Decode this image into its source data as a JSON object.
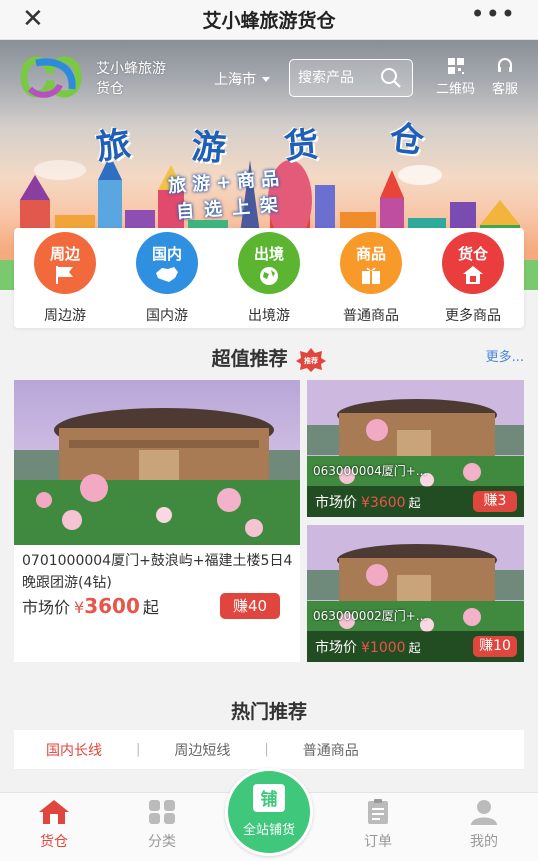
{
  "titlebar": {
    "title": "艾小蜂旅游货仓",
    "close_icon": "close-icon",
    "more_icon": "more-dots-icon"
  },
  "header": {
    "brand_line1": "艾小蜂旅游",
    "brand_line2": "货仓",
    "city": "上海市",
    "search_placeholder": "搜索产品",
    "qr_label": "二维码",
    "service_label": "客服"
  },
  "banner": {
    "headline": [
      "旅",
      "游",
      "货",
      "仓"
    ],
    "subline1": "旅游+商品",
    "subline2": "自选上架"
  },
  "categories": [
    {
      "icon_text": "周边",
      "label": "周边游",
      "color": "#f26a3b",
      "icon": "flag-icon"
    },
    {
      "icon_text": "国内",
      "label": "国内游",
      "color": "#2f8fe0",
      "icon": "china-map-icon"
    },
    {
      "icon_text": "出境",
      "label": "出境游",
      "color": "#5cb531",
      "icon": "globe-icon"
    },
    {
      "icon_text": "商品",
      "label": "普通商品",
      "color": "#f79a2a",
      "icon": "gift-icon"
    },
    {
      "icon_text": "货仓",
      "label": "更多商品",
      "color": "#ea3d3d",
      "icon": "house-icon"
    }
  ],
  "featured": {
    "title": "超值推荐",
    "badge": "推荐",
    "more": "更多...",
    "products": [
      {
        "name": "0701000004厦门+鼓浪屿+福建土楼5日4晚跟团游(4钻)",
        "price_label": "市场价",
        "currency": "¥",
        "price": "3600",
        "suffix": "起",
        "earn": "赚40"
      },
      {
        "name": "063000004厦门+...",
        "price_label": "市场价",
        "currency": "¥",
        "price": "3600",
        "suffix": "起",
        "earn": "赚3"
      },
      {
        "name": "063000002厦门+...",
        "price_label": "市场价",
        "currency": "¥",
        "price": "1000",
        "suffix": "起",
        "earn": "赚10"
      }
    ]
  },
  "hot": {
    "title": "热门推荐",
    "tabs": [
      "国内长线",
      "周边短线",
      "普通商品"
    ],
    "active_tab": 0
  },
  "nav": {
    "items": [
      {
        "label": "货仓",
        "icon": "home-icon",
        "active": true
      },
      {
        "label": "分类",
        "icon": "category-icon",
        "active": false
      },
      {
        "label": "订单",
        "icon": "order-icon",
        "active": false
      },
      {
        "label": "我的",
        "icon": "user-icon",
        "active": false
      }
    ],
    "center_icon_text": "铺",
    "center_label": "全站铺货"
  },
  "colors": {
    "accent": "#e0463d",
    "link": "#4a86d8",
    "green": "#3fc77c",
    "banner_blue": "#1f5fb8"
  }
}
